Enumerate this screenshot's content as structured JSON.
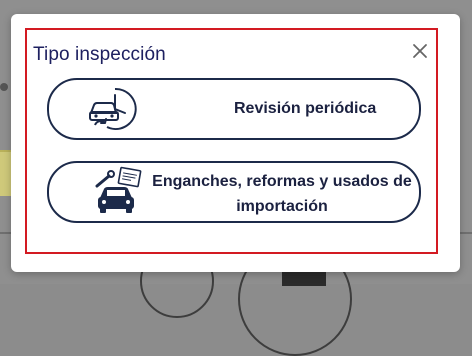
{
  "modal": {
    "title": "Tipo inspección",
    "close_icon": "close-icon",
    "options": [
      {
        "label": "Revisión periódica",
        "icon": "car-clock-icon"
      },
      {
        "label": "Enganches, reformas y usados de importación",
        "icon": "car-wrench-document-icon"
      }
    ]
  },
  "colors": {
    "frame_red": "#d31a22",
    "navy": "#1c2a4a",
    "title_text": "#1e2060",
    "backdrop": "#8f8f8f"
  }
}
